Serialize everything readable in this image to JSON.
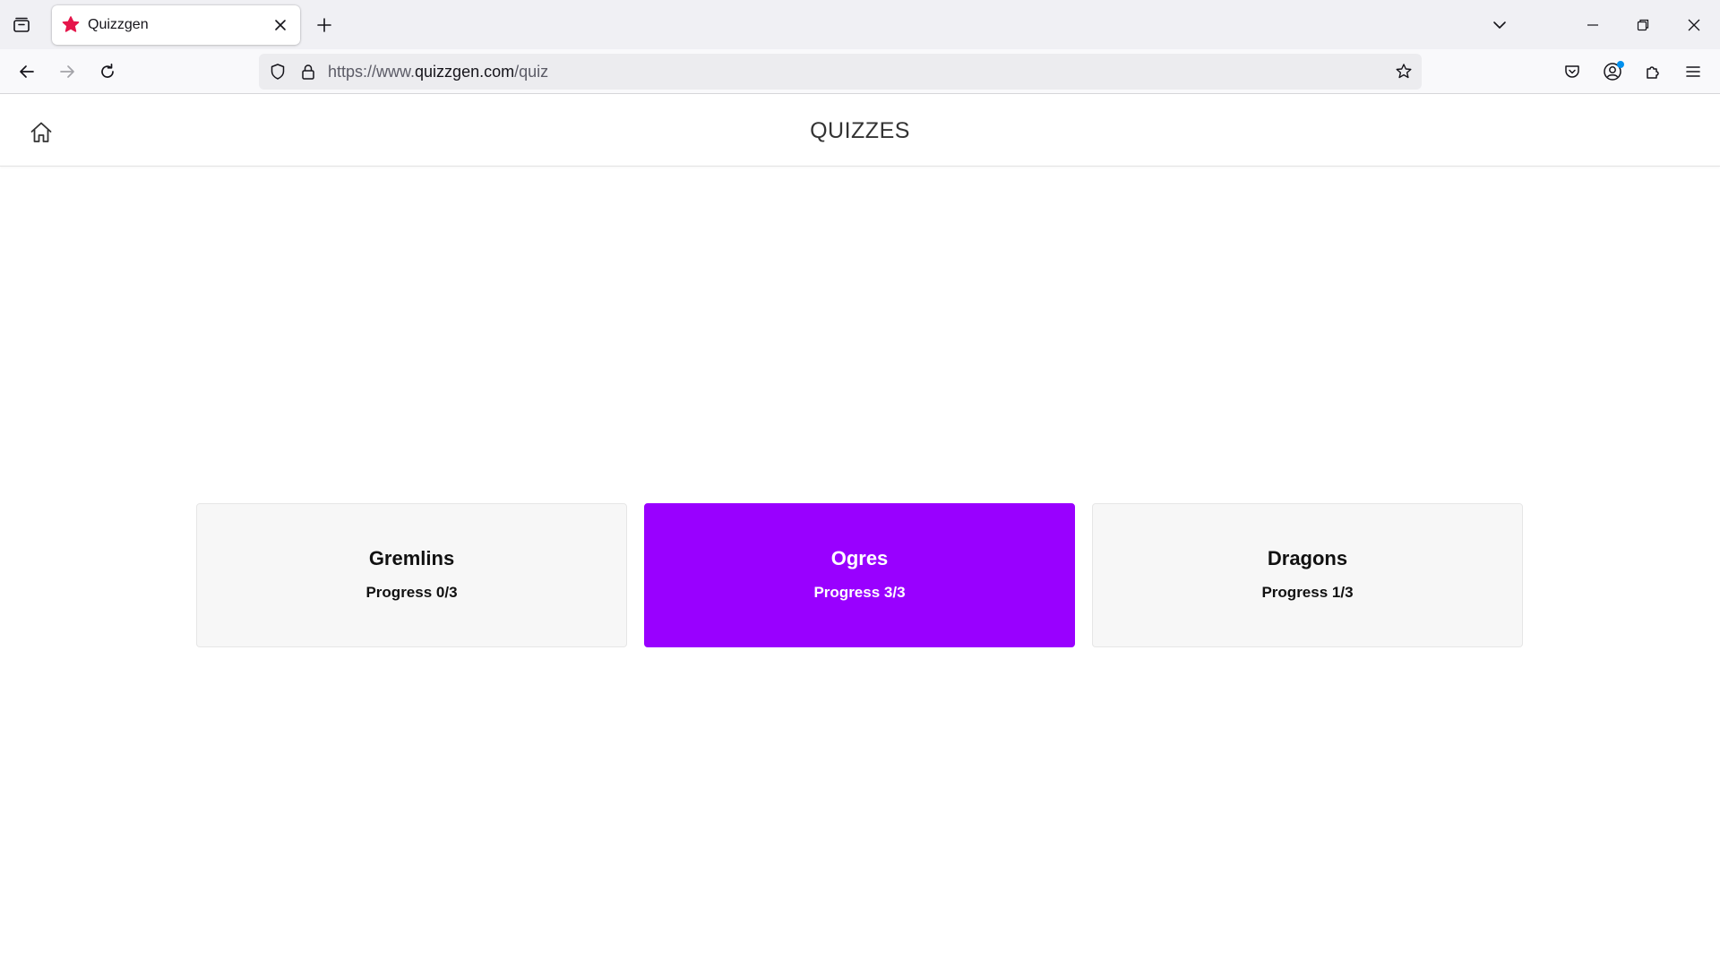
{
  "browser": {
    "tab": {
      "title": "Quizzgen",
      "favicon": "quizzgen-star-logo"
    },
    "url": {
      "prefix": "https://www.",
      "host": "quizzgen.com",
      "path": "/quiz"
    }
  },
  "header": {
    "title": "QUIZZES",
    "home_icon": "home-icon"
  },
  "quizzes": [
    {
      "name": "Gremlins",
      "progress_label": "Progress 0/3",
      "completed": 0,
      "total": 3,
      "selected": false
    },
    {
      "name": "Ogres",
      "progress_label": "Progress 3/3",
      "completed": 3,
      "total": 3,
      "selected": true
    },
    {
      "name": "Dragons",
      "progress_label": "Progress 1/3",
      "completed": 1,
      "total": 3,
      "selected": false
    }
  ],
  "colors": {
    "accent": "#9900ff",
    "favicon": "#e5164b",
    "card_background": "#f7f7f7"
  }
}
